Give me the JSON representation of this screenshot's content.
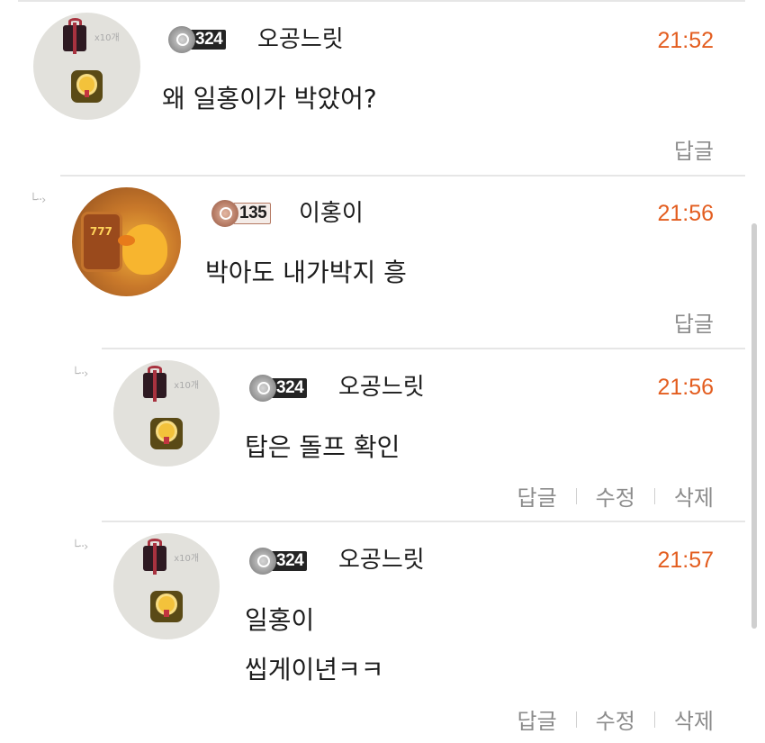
{
  "comments": [
    {
      "avatar": "gift-box-avatar",
      "gift_count": "x10개",
      "level": "324",
      "level_style": "silver",
      "username": "오공느릿",
      "time": "21:52",
      "lines": [
        "왜 일홍이가 박았어?"
      ],
      "actions": [
        "답글"
      ]
    },
    {
      "avatar": "duck-slot-avatar",
      "avatar_label": "777",
      "level": "135",
      "level_style": "bronze",
      "username": "이홍이",
      "time": "21:56",
      "lines": [
        "박아도 내가박지 흥"
      ],
      "actions": [
        "답글"
      ]
    },
    {
      "avatar": "gift-box-avatar",
      "gift_count": "x10개",
      "level": "324",
      "level_style": "silver",
      "username": "오공느릿",
      "time": "21:56",
      "lines": [
        "탑은 돌프 확인"
      ],
      "actions": [
        "답글",
        "수정",
        "삭제"
      ]
    },
    {
      "avatar": "gift-box-avatar",
      "gift_count": "x10개",
      "level": "324",
      "level_style": "silver",
      "username": "오공느릿",
      "time": "21:57",
      "lines": [
        "일홍이",
        "씹게이년ㅋㅋ"
      ],
      "actions": [
        "답글",
        "수정",
        "삭제"
      ]
    }
  ],
  "colors": {
    "time": "#e35d1f",
    "text": "#1c1c1c",
    "action": "#8c8c8c",
    "divider": "#e6e6e6"
  }
}
